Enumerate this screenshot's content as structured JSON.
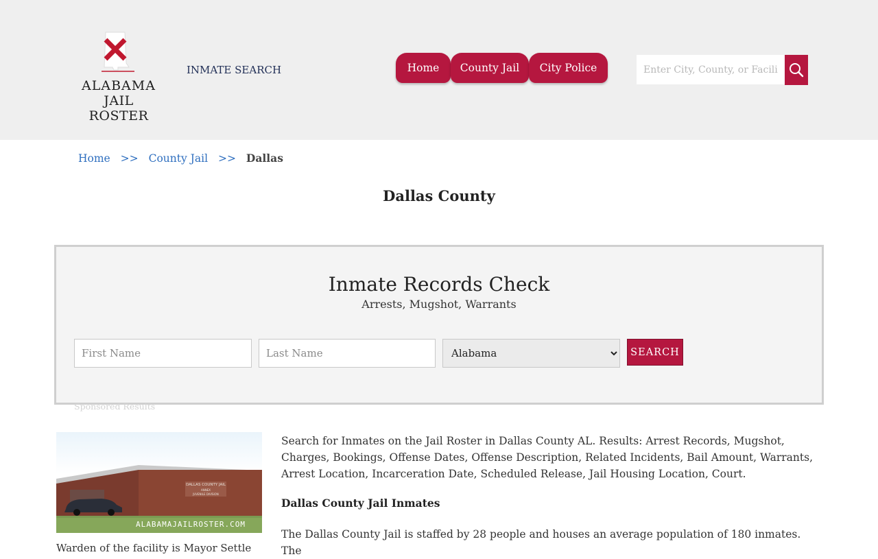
{
  "header": {
    "logo_line1": "ALABAMA",
    "logo_line2": "JAIL ROSTER",
    "inmate_search_label": "INMATE SEARCH",
    "nav": [
      {
        "label": "Home"
      },
      {
        "label": "County Jail"
      },
      {
        "label": "City Police"
      }
    ],
    "search_placeholder": "Enter City, County, or Facility",
    "search_icon": "magnifier-icon",
    "accent_color": "#b5173f"
  },
  "breadcrumb": {
    "items": [
      {
        "label": "Home"
      },
      {
        "label": "County Jail"
      }
    ],
    "separator": ">>",
    "current": "Dallas"
  },
  "page_title": "Dallas County",
  "records_check": {
    "title": "Inmate Records Check",
    "subtitle": "Arrests, Mugshot, Warrants",
    "first_name_placeholder": "First Name",
    "last_name_placeholder": "Last Name",
    "state_selected": "Alabama",
    "search_label": "SEARCH"
  },
  "sponsored_label": "Sponsored Results",
  "facility": {
    "sign_line1": "DALLAS COUNTY JAIL",
    "sign_line2": "ANNEX",
    "sign_line3": "JUVENILE DIVISION",
    "watermark": "ALABAMAJAILROSTER.COM",
    "caption": "Warden of the facility is Mayor Settle"
  },
  "content": {
    "intro": "Search for Inmates on the Jail Roster in Dallas County AL. Results: Arrest Records, Mugshot, Charges, Bookings, Offense Dates, Offense Description, Related Incidents, Bail Amount, Warrants, Arrest Location, Incarceration Date, Scheduled Release, Jail Housing Location, Court.",
    "heading": "Dallas County Jail Inmates",
    "body": "The Dallas County Jail is staffed by 28 people and houses an average population of 180 inmates. The"
  }
}
